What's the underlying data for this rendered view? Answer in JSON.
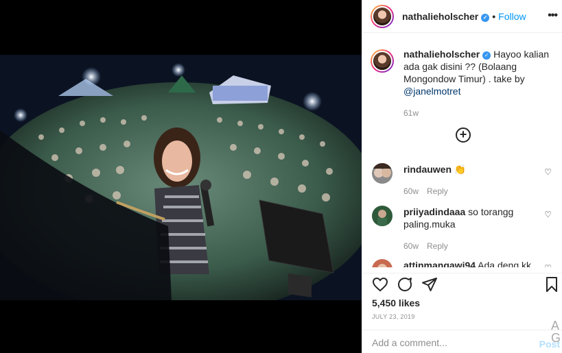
{
  "post": {
    "username": "nathalieholscher",
    "verified": true,
    "separator": "•",
    "follow_label": "Follow",
    "more_label": "•••",
    "caption": {
      "username": "nathalieholscher",
      "text_before": "Hayoo kalian ada gak disini ?? (Bolaang Mongondow Timur) . take by ",
      "mention": "@janelmotret",
      "time": "61w"
    },
    "load_more_icon": "plus-circle-icon",
    "comments": [
      {
        "username": "rindauwen",
        "text": "👏",
        "time": "60w",
        "reply_label": "Reply"
      },
      {
        "username": "priiyadindaaa",
        "text": "so torangg paling.muka",
        "time": "60w",
        "reply_label": "Reply"
      },
      {
        "username": "attinmangawi94",
        "text": "Ada deng kk",
        "time": "",
        "reply_label": ""
      }
    ],
    "likes": "5,450 likes",
    "date": "JULY 23, 2019",
    "add_comment_placeholder": "Add a comment...",
    "post_button": "Post",
    "side_glyph": "A\nG"
  },
  "colors": {
    "link_blue": "#0095f6",
    "verified_blue": "#3897f0",
    "post_disabled": "#b2dffc",
    "muted": "#8e8e8e"
  }
}
